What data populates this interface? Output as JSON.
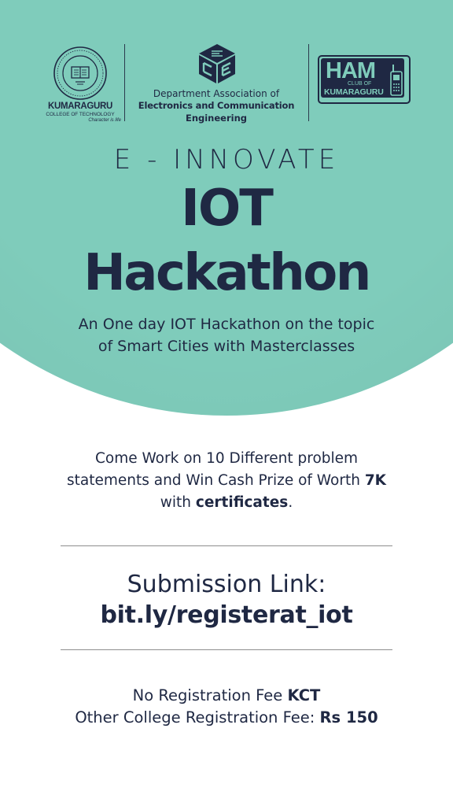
{
  "colors": {
    "teal": "#7fccbb",
    "navy": "#1f2843",
    "white": "#ffffff",
    "rule": "#8e8e8e"
  },
  "logos": {
    "college": {
      "icon": "college-seal-icon",
      "name": "KUMARAGURU",
      "subtitle": "COLLEGE OF TECHNOLOGY",
      "tagline": "Character is life"
    },
    "department": {
      "icon": "ece-cube-logo-icon",
      "line1": "Department Association of",
      "line2": "Electronics and Communication",
      "line3": "Engineering"
    },
    "ham_club": {
      "icon": "walkie-talkie-icon",
      "word": "HAM",
      "club": "CLUB OF",
      "institution": "KUMARAGURU"
    }
  },
  "event": {
    "kicker": "E - INNOVATE",
    "title_line1": "IOT",
    "title_line2": "Hackathon",
    "description": "An One day IOT Hackathon on the topic of Smart Cities with Masterclasses"
  },
  "prize": {
    "text_before": "Come Work on 10 Different problem statements and Win Cash Prize of Worth ",
    "amount": "7K",
    "text_middle": " with ",
    "reward": "certificates",
    "text_after": "."
  },
  "submission": {
    "label": "Submission Link:",
    "link": "bit.ly/registerat_iot"
  },
  "fees": {
    "kct_prefix": "No Registration Fee ",
    "kct_value": "KCT",
    "other_prefix": "Other College Registration Fee: ",
    "other_value": "Rs 150"
  }
}
